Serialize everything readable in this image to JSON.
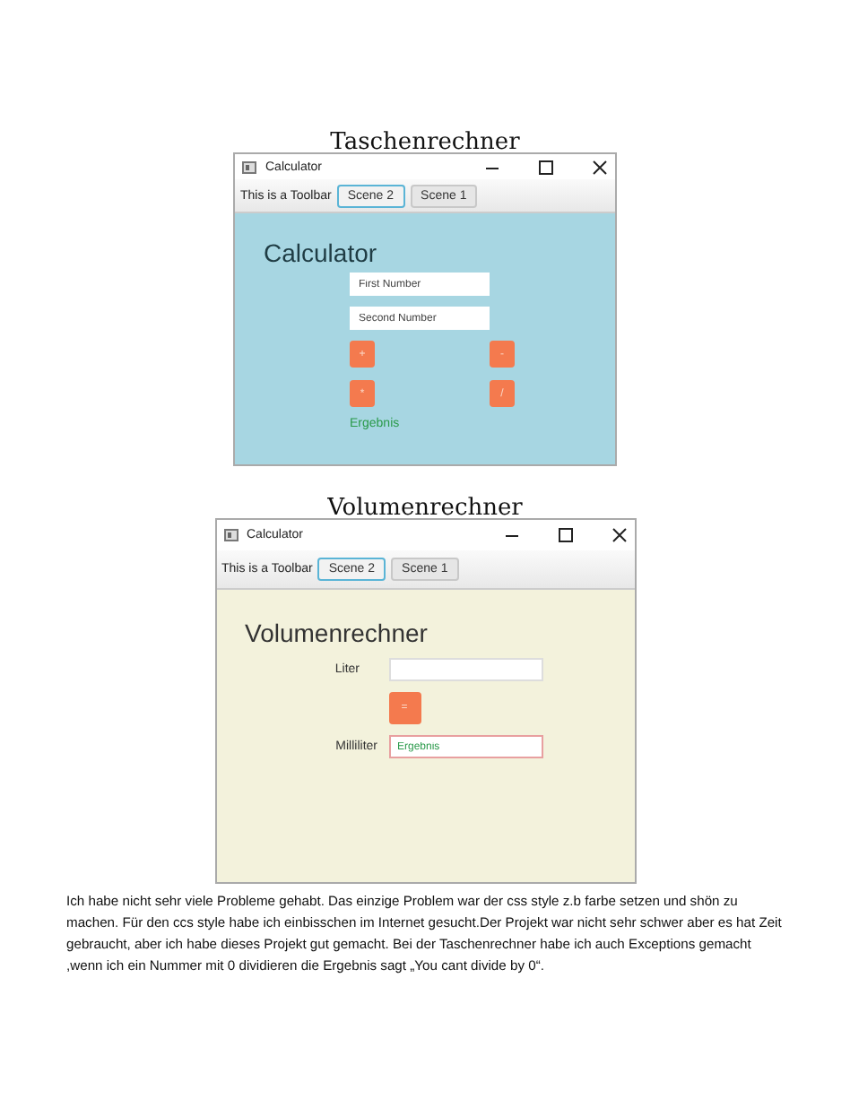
{
  "sections": [
    {
      "heading": "Taschenrechner",
      "window": {
        "title": "Calculator",
        "toolbar_label": "This is a Toolbar",
        "tabs": [
          {
            "label": "Scene 2",
            "selected": true
          },
          {
            "label": "Scene 1",
            "selected": false
          }
        ]
      },
      "content": {
        "kind": "calculator",
        "title": "Calculator",
        "fields": [
          {
            "placeholder": "First Number"
          },
          {
            "placeholder": "Second Number"
          }
        ],
        "operators": [
          "+",
          "-",
          "*",
          "/"
        ],
        "result": "Ergebnis"
      }
    },
    {
      "heading": "Volumenrechner",
      "window": {
        "title": "Calculator",
        "toolbar_label": "This is a Toolbar",
        "tabs": [
          {
            "label": "Scene 2",
            "selected": true
          },
          {
            "label": "Scene 1",
            "selected": false
          }
        ]
      },
      "content": {
        "kind": "volume",
        "title": "Volumenrechner",
        "input_label": "Liter",
        "button": "=",
        "output_label": "Milliliter",
        "output_placeholder": "Ergebnis"
      }
    }
  ],
  "paragraph": "Ich habe nicht sehr viele Probleme gehabt. Das einzige Problem war der css style z.b farbe setzen und shön zu machen. Für den ccs style habe ich einbisschen im Internet gesucht.Der Projekt war nicht sehr schwer aber es hat Zeit gebraucht, aber ich habe dieses Projekt gut gemacht. Bei der Taschenrechner habe ich auch Exceptions gemacht ,wenn ich ein Nummer mit 0 dividieren die Ergebnis sagt „You cant divide by 0“."
}
